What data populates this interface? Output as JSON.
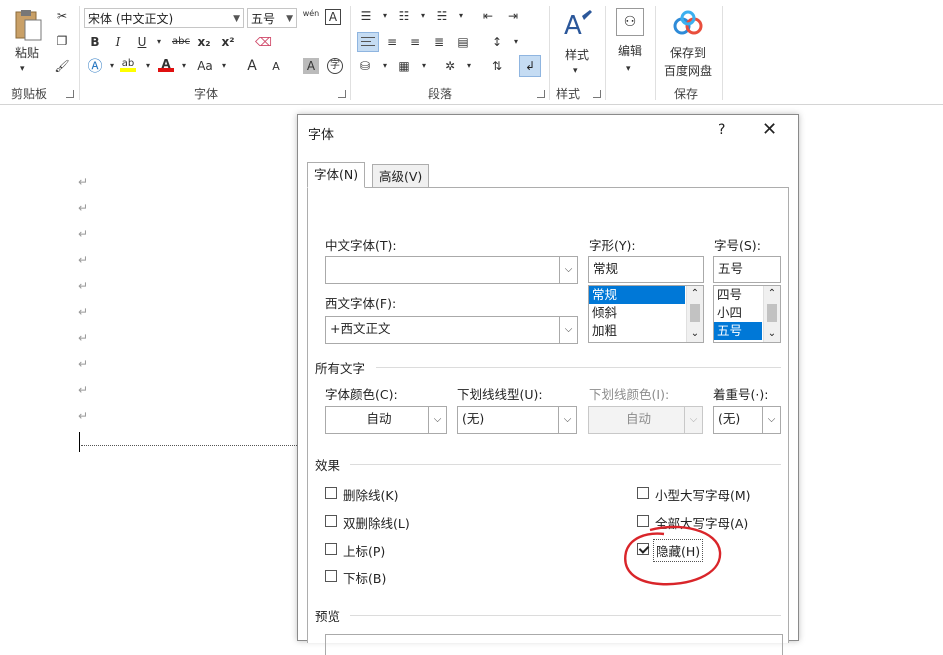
{
  "ribbon": {
    "clipboard": {
      "paste_label": "粘贴",
      "group_label": "剪贴板"
    },
    "font": {
      "font_name": "宋体 (中文正文)",
      "font_size": "五号",
      "group_label": "字体",
      "bold": "B",
      "italic": "I",
      "underline": "U",
      "strike": "abc",
      "subscript": "x₂",
      "superscript": "x²",
      "grow": "A",
      "shrink": "A",
      "case": "Aa",
      "clear": "A",
      "phonetic": "wén",
      "border_char": "A",
      "enclose": "字"
    },
    "paragraph": {
      "group_label": "段落"
    },
    "styles": {
      "label": "样式",
      "group_label": "样式"
    },
    "editing": {
      "label": "编辑"
    },
    "save": {
      "label1": "保存到",
      "label2": "百度网盘",
      "group_label": "保存"
    }
  },
  "document": {
    "paragraph_mark": "↵"
  },
  "dialog": {
    "title": "字体",
    "help": "?",
    "close": "✕",
    "tabs": [
      {
        "label": "字体(N)"
      },
      {
        "label": "高级(V)"
      }
    ],
    "chinese_font": {
      "label": "中文字体(T):",
      "value": ""
    },
    "western_font": {
      "label": "西文字体(F):",
      "value": "+西文正文"
    },
    "font_style": {
      "label": "字形(Y):",
      "value": "常规",
      "options": [
        "常规",
        "倾斜",
        "加粗"
      ]
    },
    "font_size": {
      "label": "字号(S):",
      "value": "五号",
      "options": [
        "四号",
        "小四",
        "五号"
      ]
    },
    "all_text": {
      "section_label": "所有文字",
      "font_color": {
        "label": "字体颜色(C):",
        "value": "自动"
      },
      "underline_type": {
        "label": "下划线线型(U):",
        "value": "(无)"
      },
      "underline_color": {
        "label": "下划线颜色(I):",
        "value": "自动"
      },
      "emphasis": {
        "label": "着重号(·):",
        "value": "(无)"
      }
    },
    "effects": {
      "section_label": "效果",
      "strikethrough": {
        "label": "删除线(K)",
        "checked": false
      },
      "double_strikethrough": {
        "label": "双删除线(L)",
        "checked": false
      },
      "superscript": {
        "label": "上标(P)",
        "checked": false
      },
      "subscript": {
        "label": "下标(B)",
        "checked": false
      },
      "small_caps": {
        "label": "小型大写字母(M)",
        "checked": false
      },
      "all_caps": {
        "label": "全部大写字母(A)",
        "checked": false
      },
      "hidden": {
        "label": "隐藏(H)",
        "checked": true
      }
    },
    "preview": {
      "section_label": "预览"
    }
  },
  "colors": {
    "accent": "#0078d7",
    "annotation": "#d9252a",
    "word_blue": "#2b579a"
  }
}
